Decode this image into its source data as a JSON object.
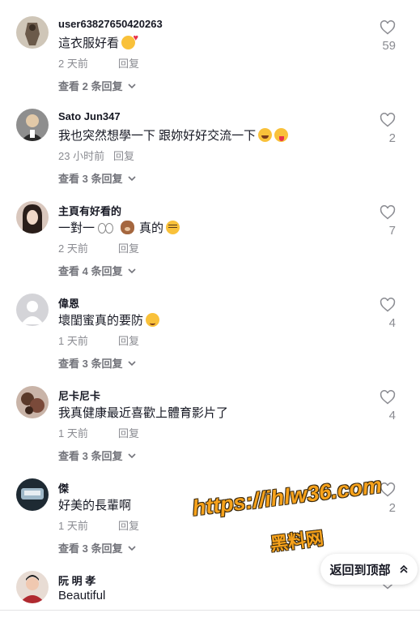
{
  "comments": [
    {
      "username": "user63827650420263",
      "text": "這衣服好看",
      "emoji": "heart",
      "date": "2 天前",
      "reply": "回复",
      "views": "查看 2 条回复",
      "likes": "59",
      "avatar_color": "#6b5a4a"
    },
    {
      "username": "Sato Jun347",
      "text": "我也突然想學一下 跟妳好好交流一下",
      "emoji": "laugh-tongue",
      "date": "23 小时前",
      "reply": "回复",
      "views": "查看 3 条回复",
      "likes": "2",
      "avatar_color": "#3a3a3a"
    },
    {
      "username": "主頁有好看的",
      "text": "一對一",
      "text_suffix": "真的",
      "emoji": "eyes-bear-plead",
      "date": "2 天前",
      "reply": "回复",
      "views": "查看 4 条回复",
      "likes": "7",
      "avatar_color": "#7a4a3a"
    },
    {
      "username": "偉恩",
      "text": "壞閨蜜真的要防",
      "emoji": "smirk",
      "date": "1 天前",
      "reply": "回复",
      "views": "查看 3 条回复",
      "likes": "4",
      "avatar_color": "#c8c8cc"
    },
    {
      "username": "尼卡尼卡",
      "text": "我真健康最近喜歡上體育影片了",
      "emoji": "",
      "date": "1 天前",
      "reply": "回复",
      "views": "查看 3 条回复",
      "likes": "4",
      "avatar_color": "#5a3a2a"
    },
    {
      "username": "傑",
      "text": "好美的長輩啊",
      "emoji": "",
      "date": "1 天前",
      "reply": "回复",
      "views": "查看 3 条回复",
      "likes": "2",
      "avatar_color": "#2a4050"
    },
    {
      "username": "阮 明 孝",
      "text": "Beautiful",
      "emoji": "",
      "likes": "",
      "avatar_color": "#b02a30"
    }
  ],
  "watermark": {
    "line1": "https://ihlw36.com",
    "line2": "黑料网"
  },
  "back_to_top": {
    "label": "返回到顶部"
  },
  "colors": {
    "text": "#161823",
    "muted": "#8a8b91",
    "accent": "#f7a21b"
  },
  "icons": {
    "like": "heart-outline-icon",
    "expand": "chevron-down-icon",
    "top": "double-chevron-up-icon"
  }
}
